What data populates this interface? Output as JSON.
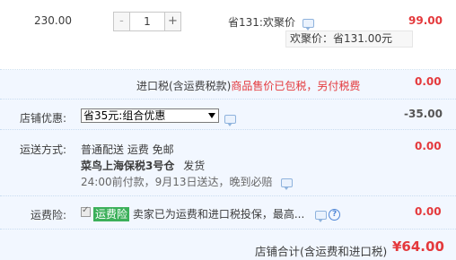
{
  "item": {
    "unit_price": "230.00",
    "quantity": "1",
    "minus": "-",
    "plus": "+",
    "saving": "省131:欢聚价",
    "subtotal": "99.00",
    "tooltip": "欢聚价：省131.00元"
  },
  "tax": {
    "label": "进口税(含运费税款)",
    "note": "商品售价已包税，另付税费",
    "amount": "0.00"
  },
  "promo": {
    "label": "店铺优惠:",
    "selected": "省35元:组合优惠",
    "amount": "-35.00"
  },
  "shipping": {
    "label": "运送方式:",
    "method": "普通配送 运费 免邮",
    "warehouse": "菜鸟上海保税3号仓",
    "dispatch": "发货",
    "eta": "24:00前付款，9月13日送达，晚到必赔",
    "amount": "0.00"
  },
  "insurance": {
    "label": "运费险:",
    "badge": "运费险",
    "text": "卖家已为运费和进口税投保，最高...",
    "amount": "0.00"
  },
  "total": {
    "label": "店铺合计(含运费和进口税)",
    "amount": "¥64.00"
  },
  "colors": {
    "accent_red": "#e4393c",
    "band_bg": "#f2f7ff",
    "badge_green": "#3cb05a",
    "link_blue": "#4f86d6"
  }
}
